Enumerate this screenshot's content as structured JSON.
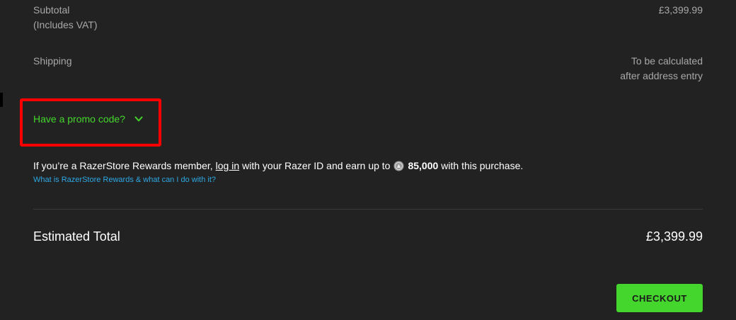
{
  "summary": {
    "subtotal_label": "Subtotal",
    "subtotal_note": "(Includes VAT)",
    "subtotal_value": "£3,399.99",
    "shipping_label": "Shipping",
    "shipping_value_line1": "To be calculated",
    "shipping_value_line2": "after address entry"
  },
  "promo": {
    "label": "Have a promo code?",
    "icon": "chevron-down-icon"
  },
  "rewards": {
    "text_before": "If you’re a RazerStore Rewards member,",
    "login_link": "log in",
    "text_middle": "with your Razer ID and earn up to",
    "coin_icon": "razer-silver-coin-icon",
    "points": "85,000",
    "text_after": "with this purchase.",
    "help_link": "What is RazerStore Rewards & what can I do with it?"
  },
  "total": {
    "label": "Estimated Total",
    "value": "£3,399.99"
  },
  "checkout": {
    "label": "CHECKOUT"
  },
  "colors": {
    "background": "#222222",
    "accent_green": "#44d62c",
    "link_blue": "#2ea8e5",
    "highlight_red": "#ff0000"
  }
}
